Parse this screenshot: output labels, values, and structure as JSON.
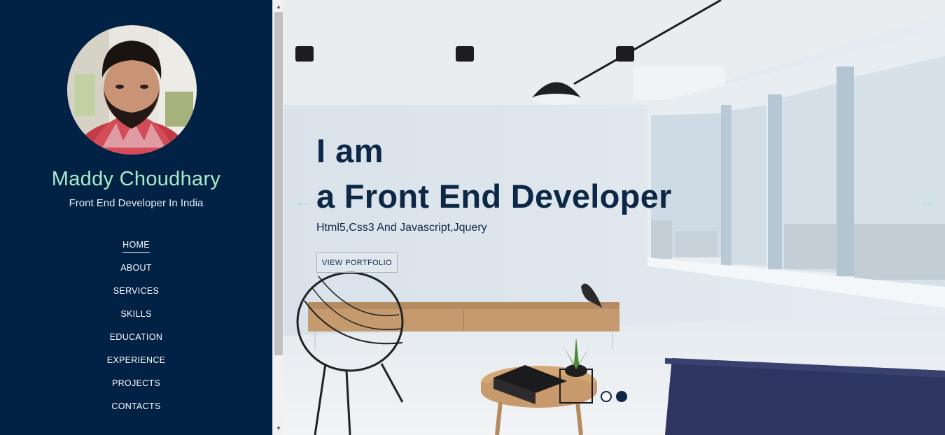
{
  "profile": {
    "name": "Maddy Choudhary",
    "tagline": "Front End Developer In India"
  },
  "nav": {
    "items": [
      {
        "label": "HOME",
        "active": true
      },
      {
        "label": "ABOUT"
      },
      {
        "label": "SERVICES"
      },
      {
        "label": "SKILLS"
      },
      {
        "label": "EDUCATION"
      },
      {
        "label": "EXPERIENCE"
      },
      {
        "label": "PROJECTS"
      },
      {
        "label": "CONTACTS"
      }
    ]
  },
  "hero": {
    "line1": "I am",
    "line2": "a Front End Developer",
    "subtitle": "Html5,Css3 And Javascript,Jquery",
    "button_label": "VIEW PORTFOLIO",
    "prev_icon": "arrow-left-icon",
    "next_icon": "arrow-right-icon",
    "slides": 2,
    "active_slide": 2
  },
  "colors": {
    "sidebar_bg": "#012145",
    "name_accent": "#a8ecc9",
    "heading": "#0d2746",
    "arrow_accent": "#8fe2c3"
  }
}
